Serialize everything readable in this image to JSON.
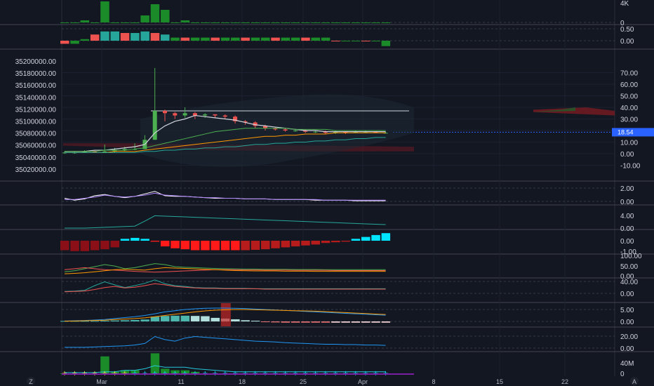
{
  "chart_data": {
    "type": "multi-pane",
    "main": {
      "type": "candlestick",
      "left_axis": {
        "ticks": [
          "35200000.00",
          "35180000.00",
          "35160000.00",
          "35140000.00",
          "35120000.00",
          "35100000.00",
          "35080000.00",
          "35060000.00",
          "35040000.00",
          "35020000.00"
        ]
      },
      "right_axis": {
        "ticks": [
          "70.00",
          "60.00",
          "50.00",
          "40.00",
          "30.00",
          "20.00",
          "10.00",
          "0.00",
          "-10.00"
        ]
      },
      "last_value_label": "18.54",
      "resistance_line": 37,
      "colors": {
        "up": "#26a69a",
        "down": "#ef5350",
        "accent": "#2962ff"
      }
    },
    "x_axis": {
      "labels": [
        "Mar",
        "11",
        "18",
        "25",
        "Apr",
        "8",
        "15",
        "22"
      ]
    },
    "panes": [
      {
        "name": "volume-top",
        "ticks": [
          "4K",
          "0"
        ]
      },
      {
        "name": "histogram-small",
        "ticks": [
          "0.50",
          "0.00"
        ]
      },
      {
        "name": "oscillator-1",
        "ticks": [
          "2.00",
          "0.00"
        ]
      },
      {
        "name": "oscillator-2",
        "ticks": [
          "4.00",
          "0.00"
        ]
      },
      {
        "name": "macd-histogram",
        "ticks": [
          "0.00",
          "-1.00"
        ],
        "values": [
          -0.5,
          -0.55,
          -0.55,
          -0.5,
          -0.45,
          -0.35,
          0.1,
          0.15,
          0.1,
          -0.05,
          -0.3,
          -0.4,
          -0.45,
          -0.5,
          -0.5,
          -0.5,
          -0.5,
          -0.5,
          -0.5,
          -0.48,
          -0.45,
          -0.4,
          -0.35,
          -0.3,
          -0.25,
          -0.2,
          -0.12,
          -0.08,
          -0.05,
          0.1,
          0.2,
          0.3,
          0.4,
          0.5,
          0.6,
          0.7
        ]
      },
      {
        "name": "dmi",
        "ticks": [
          "100.00",
          "50.00",
          "0.00"
        ]
      },
      {
        "name": "stoch",
        "ticks": [
          "40.00",
          "0.00"
        ]
      },
      {
        "name": "histogram-3",
        "ticks": [
          "5.00",
          "0.00"
        ]
      },
      {
        "name": "atr",
        "ticks": [
          "20.00",
          "0.00"
        ]
      },
      {
        "name": "volume-bottom",
        "ticks": [
          "40M",
          "0"
        ]
      }
    ]
  },
  "ui": {
    "left_button": "Z",
    "right_button": "A"
  }
}
